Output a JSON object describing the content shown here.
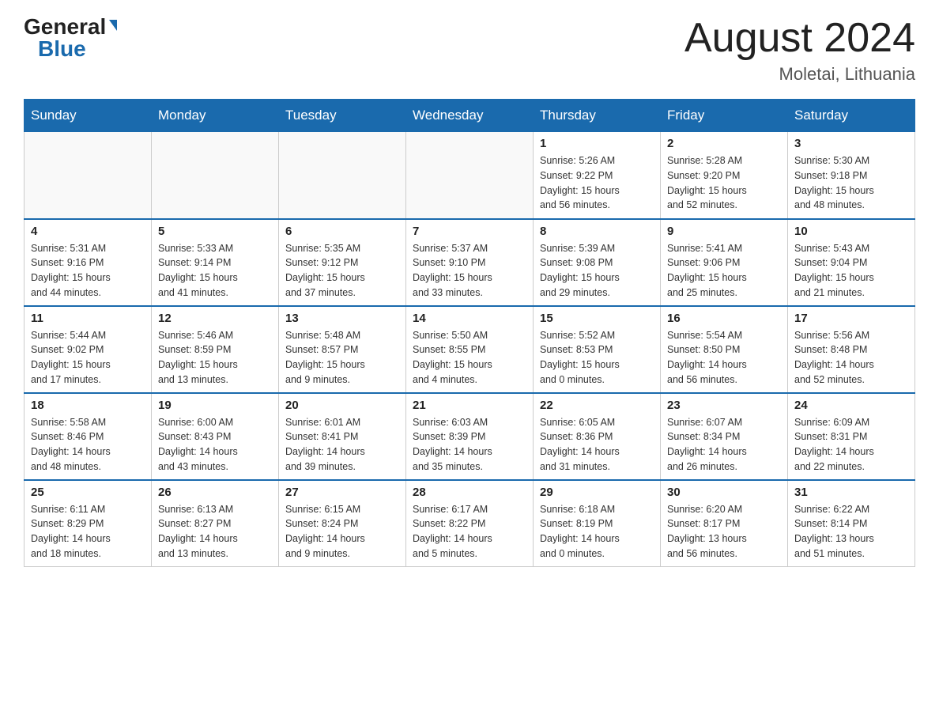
{
  "header": {
    "logo_general": "General",
    "logo_blue": "Blue",
    "title": "August 2024",
    "location": "Moletai, Lithuania"
  },
  "weekdays": [
    "Sunday",
    "Monday",
    "Tuesday",
    "Wednesday",
    "Thursday",
    "Friday",
    "Saturday"
  ],
  "weeks": [
    [
      {
        "day": "",
        "info": ""
      },
      {
        "day": "",
        "info": ""
      },
      {
        "day": "",
        "info": ""
      },
      {
        "day": "",
        "info": ""
      },
      {
        "day": "1",
        "info": "Sunrise: 5:26 AM\nSunset: 9:22 PM\nDaylight: 15 hours\nand 56 minutes."
      },
      {
        "day": "2",
        "info": "Sunrise: 5:28 AM\nSunset: 9:20 PM\nDaylight: 15 hours\nand 52 minutes."
      },
      {
        "day": "3",
        "info": "Sunrise: 5:30 AM\nSunset: 9:18 PM\nDaylight: 15 hours\nand 48 minutes."
      }
    ],
    [
      {
        "day": "4",
        "info": "Sunrise: 5:31 AM\nSunset: 9:16 PM\nDaylight: 15 hours\nand 44 minutes."
      },
      {
        "day": "5",
        "info": "Sunrise: 5:33 AM\nSunset: 9:14 PM\nDaylight: 15 hours\nand 41 minutes."
      },
      {
        "day": "6",
        "info": "Sunrise: 5:35 AM\nSunset: 9:12 PM\nDaylight: 15 hours\nand 37 minutes."
      },
      {
        "day": "7",
        "info": "Sunrise: 5:37 AM\nSunset: 9:10 PM\nDaylight: 15 hours\nand 33 minutes."
      },
      {
        "day": "8",
        "info": "Sunrise: 5:39 AM\nSunset: 9:08 PM\nDaylight: 15 hours\nand 29 minutes."
      },
      {
        "day": "9",
        "info": "Sunrise: 5:41 AM\nSunset: 9:06 PM\nDaylight: 15 hours\nand 25 minutes."
      },
      {
        "day": "10",
        "info": "Sunrise: 5:43 AM\nSunset: 9:04 PM\nDaylight: 15 hours\nand 21 minutes."
      }
    ],
    [
      {
        "day": "11",
        "info": "Sunrise: 5:44 AM\nSunset: 9:02 PM\nDaylight: 15 hours\nand 17 minutes."
      },
      {
        "day": "12",
        "info": "Sunrise: 5:46 AM\nSunset: 8:59 PM\nDaylight: 15 hours\nand 13 minutes."
      },
      {
        "day": "13",
        "info": "Sunrise: 5:48 AM\nSunset: 8:57 PM\nDaylight: 15 hours\nand 9 minutes."
      },
      {
        "day": "14",
        "info": "Sunrise: 5:50 AM\nSunset: 8:55 PM\nDaylight: 15 hours\nand 4 minutes."
      },
      {
        "day": "15",
        "info": "Sunrise: 5:52 AM\nSunset: 8:53 PM\nDaylight: 15 hours\nand 0 minutes."
      },
      {
        "day": "16",
        "info": "Sunrise: 5:54 AM\nSunset: 8:50 PM\nDaylight: 14 hours\nand 56 minutes."
      },
      {
        "day": "17",
        "info": "Sunrise: 5:56 AM\nSunset: 8:48 PM\nDaylight: 14 hours\nand 52 minutes."
      }
    ],
    [
      {
        "day": "18",
        "info": "Sunrise: 5:58 AM\nSunset: 8:46 PM\nDaylight: 14 hours\nand 48 minutes."
      },
      {
        "day": "19",
        "info": "Sunrise: 6:00 AM\nSunset: 8:43 PM\nDaylight: 14 hours\nand 43 minutes."
      },
      {
        "day": "20",
        "info": "Sunrise: 6:01 AM\nSunset: 8:41 PM\nDaylight: 14 hours\nand 39 minutes."
      },
      {
        "day": "21",
        "info": "Sunrise: 6:03 AM\nSunset: 8:39 PM\nDaylight: 14 hours\nand 35 minutes."
      },
      {
        "day": "22",
        "info": "Sunrise: 6:05 AM\nSunset: 8:36 PM\nDaylight: 14 hours\nand 31 minutes."
      },
      {
        "day": "23",
        "info": "Sunrise: 6:07 AM\nSunset: 8:34 PM\nDaylight: 14 hours\nand 26 minutes."
      },
      {
        "day": "24",
        "info": "Sunrise: 6:09 AM\nSunset: 8:31 PM\nDaylight: 14 hours\nand 22 minutes."
      }
    ],
    [
      {
        "day": "25",
        "info": "Sunrise: 6:11 AM\nSunset: 8:29 PM\nDaylight: 14 hours\nand 18 minutes."
      },
      {
        "day": "26",
        "info": "Sunrise: 6:13 AM\nSunset: 8:27 PM\nDaylight: 14 hours\nand 13 minutes."
      },
      {
        "day": "27",
        "info": "Sunrise: 6:15 AM\nSunset: 8:24 PM\nDaylight: 14 hours\nand 9 minutes."
      },
      {
        "day": "28",
        "info": "Sunrise: 6:17 AM\nSunset: 8:22 PM\nDaylight: 14 hours\nand 5 minutes."
      },
      {
        "day": "29",
        "info": "Sunrise: 6:18 AM\nSunset: 8:19 PM\nDaylight: 14 hours\nand 0 minutes."
      },
      {
        "day": "30",
        "info": "Sunrise: 6:20 AM\nSunset: 8:17 PM\nDaylight: 13 hours\nand 56 minutes."
      },
      {
        "day": "31",
        "info": "Sunrise: 6:22 AM\nSunset: 8:14 PM\nDaylight: 13 hours\nand 51 minutes."
      }
    ]
  ]
}
